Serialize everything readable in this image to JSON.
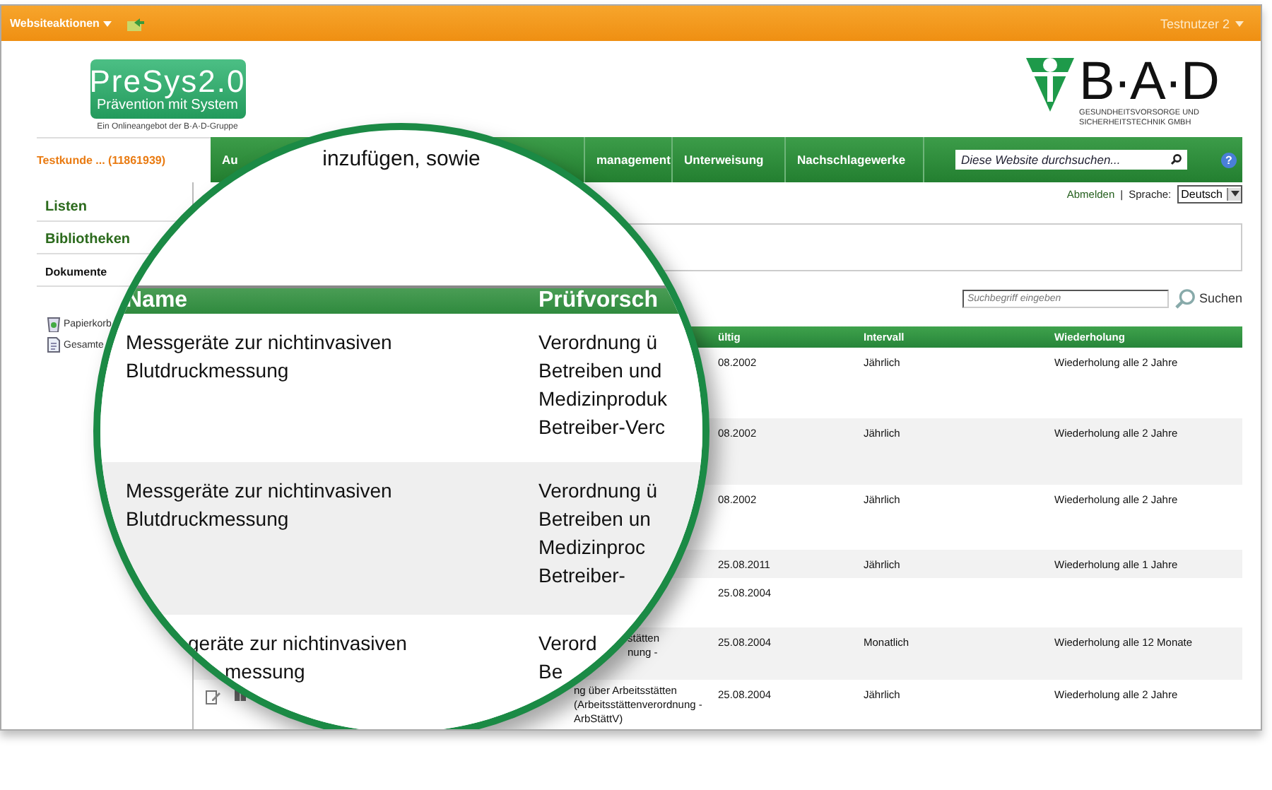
{
  "top_bar": {
    "menu": "Websiteaktionen",
    "user": "Testnutzer 2"
  },
  "header": {
    "logo_title": "PreSys2.0",
    "logo_subtitle": "Prävention mit System",
    "logo_caption": "Ein Onlineangebot der B·A·D-Gruppe",
    "brand": "B·A·D",
    "brand_lines": [
      "GESUNDHEITSVORSORGE UND",
      "SICHERHEITSTECHNIK GMBH"
    ]
  },
  "customer": "Testkunde ... (11861939)",
  "nav": {
    "items": [
      "Au",
      "management",
      "Unterweisung",
      "Nachschlagewerke"
    ],
    "search": {
      "placeholder": "Diese Website durchsuchen..."
    },
    "help": "?"
  },
  "user_links": {
    "logout": "Abmelden",
    "separator": "|",
    "language_label": "Sprache:",
    "language": "Deutsch"
  },
  "sidebar": {
    "items": [
      {
        "label": "Listen",
        "selected": false
      },
      {
        "label": "Bibliotheken",
        "selected": false
      },
      {
        "label": "Dokumente",
        "selected": true
      }
    ],
    "tools": [
      {
        "label": "Papierkorb",
        "kind": "trash"
      },
      {
        "label": "Gesamte",
        "kind": "document"
      }
    ]
  },
  "search": {
    "placeholder": "Suchbegriff eingeben",
    "button": "Suchen"
  },
  "table": {
    "columns": [
      "ültig",
      "Intervall",
      "Wiederholung"
    ],
    "rows": [
      {
        "valid": "08.2002",
        "interval": "Jährlich",
        "repeat": "Wiederholung alle 2 Jahre"
      },
      {
        "valid": "08.2002",
        "interval": "Jährlich",
        "repeat": "Wiederholung alle 2 Jahre"
      },
      {
        "valid": "08.2002",
        "interval": "Jährlich",
        "repeat": "Wiederholung alle 2 Jahre"
      },
      {
        "valid": "25.08.2011",
        "interval": "Jährlich",
        "repeat": "Wiederholung alle 1 Jahre"
      },
      {
        "valid": "25.08.2004"
      },
      {
        "rule_lines": [
          "stätten",
          "nung -"
        ],
        "valid": "25.08.2004",
        "interval": "Monatlich",
        "repeat": "Wiederholung alle 12 Monate"
      },
      {
        "rule_lines": [
          "ng über Arbeitsstätten",
          "(Arbeitsstättenverordnung -",
          "ArbStättV)"
        ],
        "valid": "25.08.2004",
        "interval": "Jährlich",
        "repeat": "Wiederholung alle 2 Jahre",
        "actions": true
      }
    ]
  },
  "magnifier": {
    "teaser": "inzufügen, sowie",
    "columns": [
      "Name",
      "Prüfvorsch"
    ],
    "rows": [
      {
        "name_lines": [
          "Messgeräte zur nichtinvasiven",
          "Blutdruckmessung"
        ],
        "rule_lines": [
          "Verordnung ü",
          "Betreiben und",
          "Medizinproduk",
          "Betreiber-Verc"
        ]
      },
      {
        "name_lines": [
          "Messgeräte zur nichtinvasiven",
          "Blutdruckmessung"
        ],
        "rule_lines": [
          "Verordnung ü",
          "Betreiben un",
          "Medizinproc",
          "Betreiber-"
        ]
      },
      {
        "name_lines": [
          "geräte zur nichtinvasiven",
          "messung"
        ],
        "rule_lines": [
          "Verord",
          "Be"
        ]
      }
    ]
  }
}
